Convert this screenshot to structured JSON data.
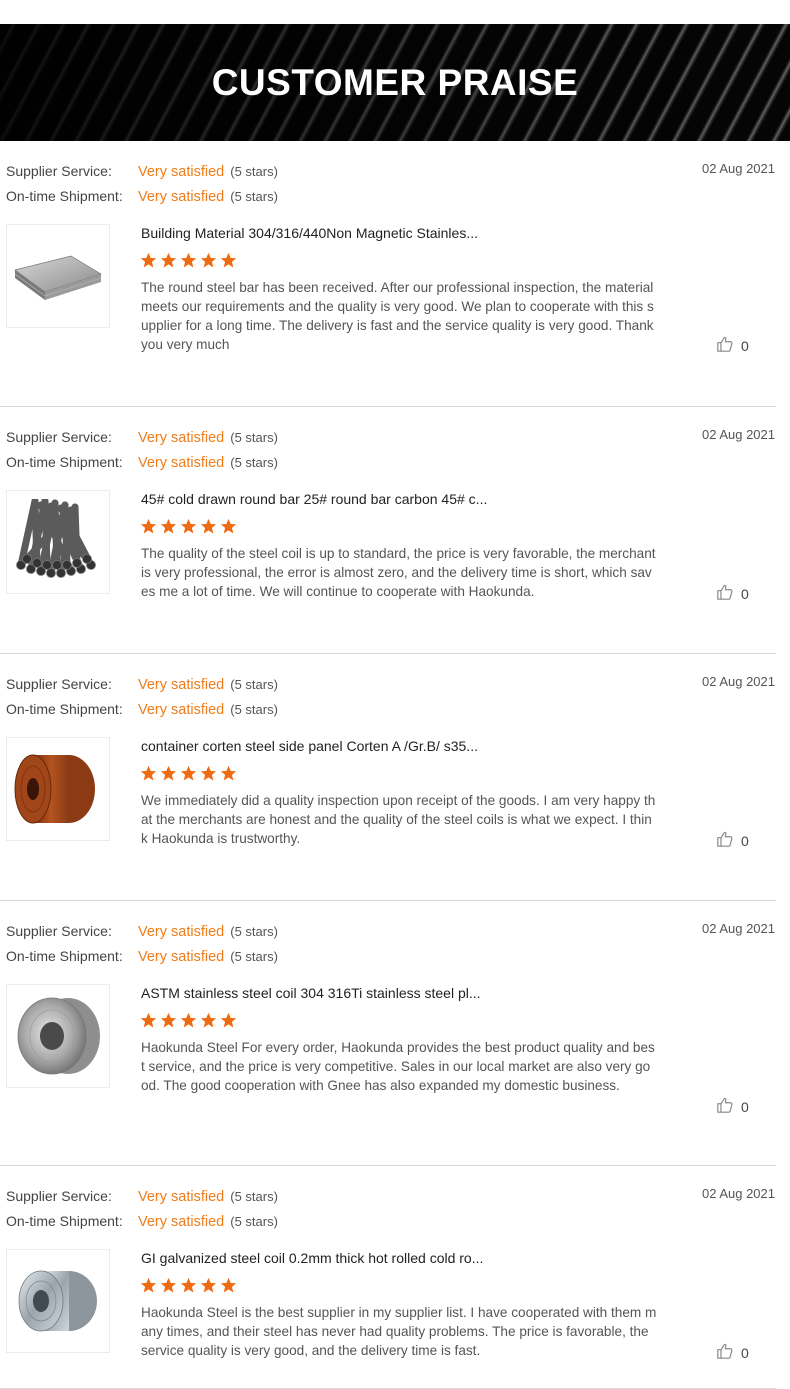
{
  "banner": {
    "title": "CUSTOMER PRAISE"
  },
  "labels": {
    "supplier_service": "Supplier Service:",
    "ontime_shipment": "On-time Shipment:"
  },
  "colors": {
    "accent": "#f07d1a",
    "banner": "#050505"
  },
  "reviews": [
    {
      "supplier_value": "Very satisfied",
      "supplier_stars": "(5 stars)",
      "shipment_value": "Very satisfied",
      "shipment_stars": "(5 stars)",
      "date": "02 Aug 2021",
      "product_title": "Building Material 304/316/440Non Magnetic Stainles...",
      "product_image": "steel-plates",
      "rating": 5,
      "text": "The round steel bar has been received. After our professional inspection, the material meets our requirements and the quality is very good. We plan to cooperate with this supplier for a long time. The delivery is fast and the service quality is very good. Thank you very much",
      "likes": "0"
    },
    {
      "supplier_value": "Very satisfied",
      "supplier_stars": "(5 stars)",
      "shipment_value": "Very satisfied",
      "shipment_stars": "(5 stars)",
      "date": "02 Aug 2021",
      "product_title": "45# cold drawn round bar 25# round bar carbon 45# c...",
      "product_image": "round-bars",
      "rating": 5,
      "text": "The quality of the steel coil is up to standard, the price is very favorable, the merchant is very professional, the error is almost zero, and the delivery time is short, which saves me a lot of time. We will continue to cooperate with Haokunda.",
      "likes": "0"
    },
    {
      "supplier_value": "Very satisfied",
      "supplier_stars": "(5 stars)",
      "shipment_value": "Very satisfied",
      "shipment_stars": "(5 stars)",
      "date": "02 Aug 2021",
      "product_title": "container corten steel side panel Corten A /Gr.B/ s35...",
      "product_image": "corten-coil",
      "rating": 5,
      "text": "We immediately did a quality inspection upon receipt of the goods. I am very happy that the merchants are honest and the quality of the steel coils is what we expect. I think Haokunda is trustworthy.",
      "likes": "0"
    },
    {
      "supplier_value": "Very satisfied",
      "supplier_stars": "(5 stars)",
      "shipment_value": "Very satisfied",
      "shipment_stars": "(5 stars)",
      "date": "02 Aug 2021",
      "product_title": "ASTM stainless steel coil 304 316Ti stainless steel pl...",
      "product_image": "stainless-coil",
      "rating": 5,
      "text": "Haokunda Steel For every order, Haokunda provides the best product quality and best service, and the price is very competitive. Sales in our local market are also very good. The good cooperation with Gnee has also expanded my domestic business.",
      "likes": "0"
    },
    {
      "supplier_value": "Very satisfied",
      "supplier_stars": "(5 stars)",
      "shipment_value": "Very satisfied",
      "shipment_stars": "(5 stars)",
      "date": "02 Aug 2021",
      "product_title": "GI galvanized steel coil 0.2mm thick hot rolled cold ro...",
      "product_image": "galvanized-coil",
      "rating": 5,
      "text": "Haokunda Steel is the best supplier in my supplier list. I have cooperated with them many times, and their steel has never had quality problems. The price is favorable, the service quality is very good, and the delivery time is fast.",
      "likes": "0"
    }
  ]
}
